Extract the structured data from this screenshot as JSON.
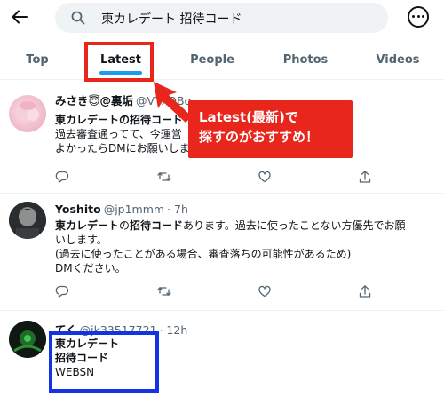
{
  "search": {
    "query": "東カレデート 招待コード"
  },
  "tabs": [
    {
      "label": "Top"
    },
    {
      "label": "Latest"
    },
    {
      "label": "People"
    },
    {
      "label": "Photos"
    },
    {
      "label": "Videos"
    }
  ],
  "tweets": [
    {
      "name": "みさき😇@裏垢",
      "handle": "@VTxQBq",
      "lines": [
        {
          "bold": "東カレデートの招待コード",
          "rest": "",
          "tail": "？"
        },
        {
          "bold": "",
          "rest": "過去審査通ってて、今運営"
        },
        {
          "bold": "",
          "rest": "よかったらDMにお願いしま"
        }
      ]
    },
    {
      "name": "Yoshito",
      "handle": "@jp1mmm",
      "time": "· 7h",
      "lines": [
        {
          "bold": "東カレデート",
          "rest": "の",
          "bold2": "招待コード",
          "rest2": "あります。過去に使ったことない方優先でお願"
        },
        {
          "bold": "",
          "rest": "いします。"
        },
        {
          "bold": "",
          "rest": "(過去に使ったことがある場合、審査落ちの可能性があるため)"
        },
        {
          "bold": "",
          "rest": "DMください。"
        }
      ]
    },
    {
      "name": "てく",
      "handle": "@jk33517721",
      "time": "· 12h",
      "lines": [
        {
          "bold": "東カレデート",
          "rest": ""
        },
        {
          "bold": "招待コード",
          "rest": ""
        },
        {
          "bold": "",
          "rest": "WEBSN"
        }
      ]
    }
  ],
  "annotation": {
    "line1": "Latest(最新)で",
    "line2": "探すのがおすすめ！",
    "color": "#e8261b",
    "highlight_color": "#1233e6"
  },
  "accent": "#1d9bf0"
}
